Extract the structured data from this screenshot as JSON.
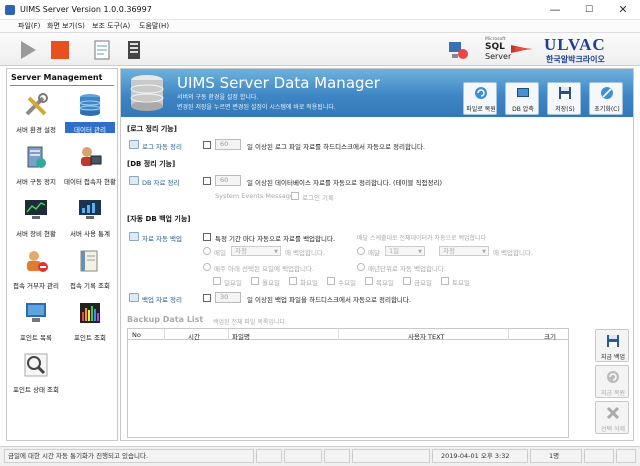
{
  "window": {
    "title": "UIMS Server Version 1.0.0.36997",
    "min": "—",
    "max": "☐",
    "close": "✕"
  },
  "menu": [
    "파일(F)",
    "화면 보기(S)",
    "보조 도구(A)",
    "도움말(H)"
  ],
  "logos": {
    "sql_small": "Microsoft",
    "sql_main": "SQL",
    "sql_sub": "Server",
    "brand_en": "ULVAC",
    "brand_kr": "한국알박크라이오"
  },
  "sidebar": {
    "header": "Server Management",
    "items": [
      {
        "label": "서버 환경 설정",
        "icon": "tools-icon"
      },
      {
        "label": "데이터 관리",
        "icon": "database-icon",
        "selected": true
      },
      {
        "label": "서버 구동 정지",
        "icon": "server-power-icon"
      },
      {
        "label": "데이터 접속자 현황",
        "icon": "user-monitor-icon"
      },
      {
        "label": "서버 장비 현황",
        "icon": "chart-monitor-icon"
      },
      {
        "label": "서버 사용 통계",
        "icon": "stats-monitor-icon"
      },
      {
        "label": "접속 거부자 관리",
        "icon": "user-block-icon"
      },
      {
        "label": "접속 기록 조회",
        "icon": "book-icon"
      },
      {
        "label": "포인트 목록",
        "icon": "list-icon"
      },
      {
        "label": "포인트 조회",
        "icon": "bars-icon"
      },
      {
        "label": "포인트 상태 조회",
        "icon": "magnifier-icon"
      }
    ]
  },
  "banner": {
    "title": "UIMS Server Data Manager",
    "sub1": "서버의 구동 환경을 설정 합니다.",
    "sub2": "변경된 저장을 누르면 변경된 설정이 시스템에 바로 적용됩니다.",
    "buttons": [
      "파일로 복원",
      "DB 압축",
      "저장(S)",
      "초기화(C)"
    ]
  },
  "log_section": {
    "title": "[로그 정리 기능]",
    "row_label": "로그 자동 정리",
    "value": "60",
    "text": "일 이상된 로그 파일 자료를 하드디스크에서 자동으로 정리합니다."
  },
  "db_section": {
    "title": "[DB 정리 기능]",
    "row_label": "DB 자료 정리",
    "value": "60",
    "text": "일 이상된 데이터베이스 자료를 자동으로 정리합니다. (테이블 직접정리)",
    "opt1": "System Events Message",
    "opt2": "로그인 기록"
  },
  "backup_section": {
    "title": "[자동 DB 백업 기능]",
    "row_label": "자료 자동 백업",
    "main_text": "특정 기간 마다 자동으로 자료를 백업합니다.",
    "right_hint": "매달 스케줄대로 전체데이터가 자동으로 백업합니다",
    "daily": "매일",
    "daily_sel": "자정",
    "daily_after": "에 백업합니다.",
    "monthly": "매달",
    "monthly_day": "1일",
    "monthly_time": "자정",
    "monthly_after": "에 백업합니다.",
    "weekly": "매주 아래 선택된 요일에 백업합니다.",
    "yearly": "매년단위로 자동 백업합니다.",
    "days": [
      "일요일",
      "월요일",
      "화요일",
      "수요일",
      "목요일",
      "금요일",
      "토요일"
    ],
    "cleanup_label": "백업 자료 정리",
    "cleanup_value": "30",
    "cleanup_text": "일 이상된 백업 파일을 하드디스크에서 자동으로 정리합니다."
  },
  "backup_list": {
    "title": "Backup Data List",
    "hint": "백업된 전체 파일 목록입니다.",
    "columns": [
      "No",
      "시간",
      "파일명",
      "사용자 TEXT",
      "크기"
    ],
    "rows": []
  },
  "side_buttons": [
    "지금 백업",
    "지금 복원",
    "선택 삭제"
  ],
  "status": {
    "message": "금일에 대한 시간 자동 통기화가 진행되고 있습니다.",
    "datetime": "2019-04-01 오후 3:32",
    "users": "1명"
  },
  "colors": {
    "accent": "#2f6fc9",
    "banner": "#3f86c4",
    "label_blue": "#2b5d99"
  }
}
